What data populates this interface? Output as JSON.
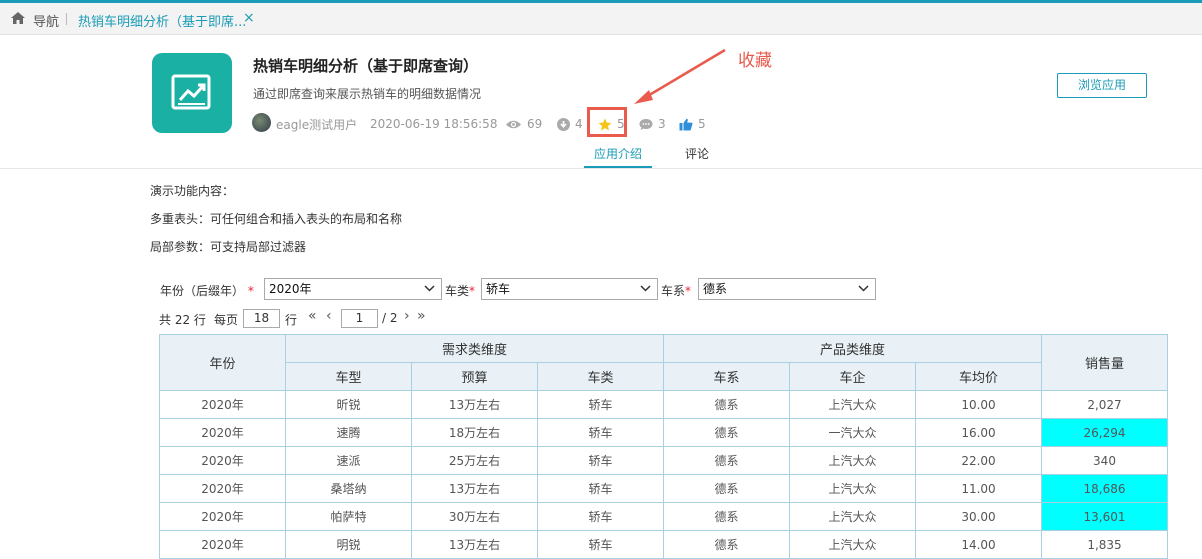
{
  "tabbar": {
    "nav_label": "导航",
    "tab_title": "热销车明细分析（基于即席...",
    "close_glyph": "×"
  },
  "app": {
    "icon": "chart-trend-icon",
    "title": "热销车明细分析（基于即席查询）",
    "description": "通过即席查询来展示热销车的明细数据情况",
    "author": "eagle测试用户",
    "datetime": "2020-06-19 18:56:58",
    "views": "69",
    "downloads": "4",
    "favorites": "5",
    "comments": "3",
    "likes": "5",
    "browse_button": "浏览应用"
  },
  "annotation": {
    "label": "收藏",
    "color": "#e85b4d"
  },
  "tabs": {
    "intro": "应用介绍",
    "comment": "评论"
  },
  "intro_lines": [
    "演示功能内容：",
    "多重表头：可任何组合和插入表头的布局和名称",
    "局部参数：可支持局部过滤器"
  ],
  "filters": {
    "year_label": "年份（后缀年）",
    "year_value": "2020年",
    "type_label": "车类",
    "type_value": "轿车",
    "series_label": "车系",
    "series_value": "德系",
    "required_mark": "*"
  },
  "pager": {
    "total": "共 22 行",
    "per_page_label": "每页",
    "per_page_value": "18",
    "row_unit": "行",
    "first": "«",
    "prev": "‹",
    "page_value": "1",
    "page_total": "/ 2",
    "next": "›",
    "last": "»"
  },
  "table": {
    "group_headers": {
      "year": "年份",
      "demand": "需求类维度",
      "product": "产品类维度",
      "sales": "销售量"
    },
    "sub_headers": [
      "车型",
      "预算",
      "车类",
      "车系",
      "车企",
      "车均价"
    ],
    "rows": [
      {
        "cells": [
          "2020年",
          "昕锐",
          "13万左右",
          "轿车",
          "德系",
          "上汽大众",
          "10.00",
          "2,027"
        ],
        "highlight": false
      },
      {
        "cells": [
          "2020年",
          "速腾",
          "18万左右",
          "轿车",
          "德系",
          "一汽大众",
          "16.00",
          "26,294"
        ],
        "highlight": true
      },
      {
        "cells": [
          "2020年",
          "速派",
          "25万左右",
          "轿车",
          "德系",
          "上汽大众",
          "22.00",
          "340"
        ],
        "highlight": false
      },
      {
        "cells": [
          "2020年",
          "桑塔纳",
          "13万左右",
          "轿车",
          "德系",
          "上汽大众",
          "11.00",
          "18,686"
        ],
        "highlight": true
      },
      {
        "cells": [
          "2020年",
          "帕萨特",
          "30万左右",
          "轿车",
          "德系",
          "上汽大众",
          "30.00",
          "13,601"
        ],
        "highlight": true
      },
      {
        "cells": [
          "2020年",
          "明锐",
          "13万左右",
          "轿车",
          "德系",
          "上汽大众",
          "14.00",
          "1,835"
        ],
        "highlight": false
      }
    ],
    "highlight_color": "#00ffff"
  }
}
